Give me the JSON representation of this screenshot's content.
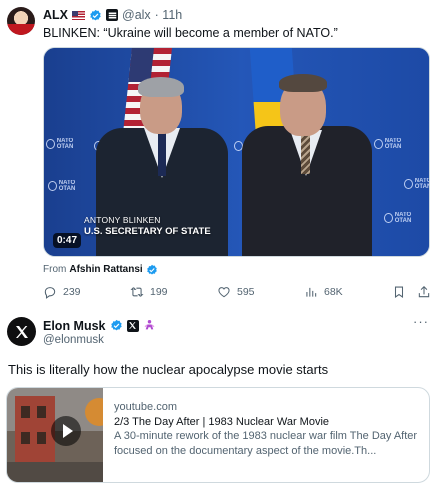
{
  "quoted_tweet": {
    "author_name": "ALX",
    "flag_icon": "us-flag-icon",
    "handle": "@alx",
    "time": "· 11h",
    "text": "BLINKEN: “Ukraine will become a member of NATO.”",
    "video": {
      "duration": "0:47",
      "caption_name": "ANTONY BLINKEN",
      "caption_title": "U.S. SECRETARY OF STATE",
      "backdrop_label": "NATO OTAN"
    },
    "from_label": "From",
    "from_name": "Afshin Rattansi",
    "stats": {
      "replies": "239",
      "reposts": "199",
      "likes": "595",
      "views": "68K"
    }
  },
  "main_tweet": {
    "author_name": "Elon Musk",
    "handle": "@elonmusk",
    "more_label": "···",
    "text": "This is literally how the nuclear apocalypse movie starts",
    "card": {
      "domain": "youtube.com",
      "title": "2/3 The Day After | 1983 Nuclear War Movie",
      "description": "A 30-minute rework of the 1983 nuclear war film The Day After focused on the documentary aspect of the movie.Th..."
    }
  },
  "colors": {
    "verified_blue": "#1d9bf0",
    "text_primary": "#0f1419",
    "text_secondary": "#536471",
    "border": "#cfd9de"
  }
}
